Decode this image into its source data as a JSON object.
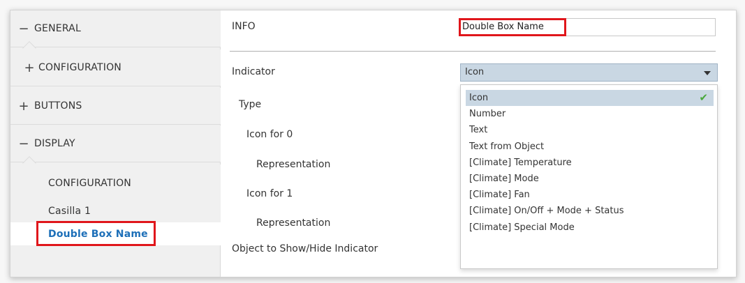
{
  "sidebar": {
    "items": [
      {
        "sign": "−",
        "label": "GENERAL"
      },
      {
        "sign": "+",
        "label": "CONFIGURATION"
      },
      {
        "sign": "+",
        "label": "BUTTONS"
      },
      {
        "sign": "−",
        "label": "DISPLAY"
      },
      {
        "label": "CONFIGURATION"
      },
      {
        "label": "Casilla 1"
      },
      {
        "label": "Double Box Name"
      }
    ]
  },
  "main": {
    "info_label": "INFO",
    "info_value": "Double Box Name",
    "rows": [
      "Indicator",
      "Type",
      "Icon for 0",
      "Representation",
      "Icon for 1",
      "Representation",
      "Object to Show/Hide Indicator"
    ],
    "select_value": "Icon",
    "options": [
      "Icon",
      "Number",
      "Text",
      "Text from Object",
      "[Climate] Temperature",
      "[Climate] Mode",
      "[Climate] Fan",
      "[Climate] On/Off + Mode + Status",
      "[Climate] Special Mode"
    ],
    "check": "✔"
  },
  "colors": {
    "selected_text": "#1d6fb8",
    "highlight": "#c9d7e3",
    "callout": "#e0161b",
    "check": "#4aa83d"
  }
}
